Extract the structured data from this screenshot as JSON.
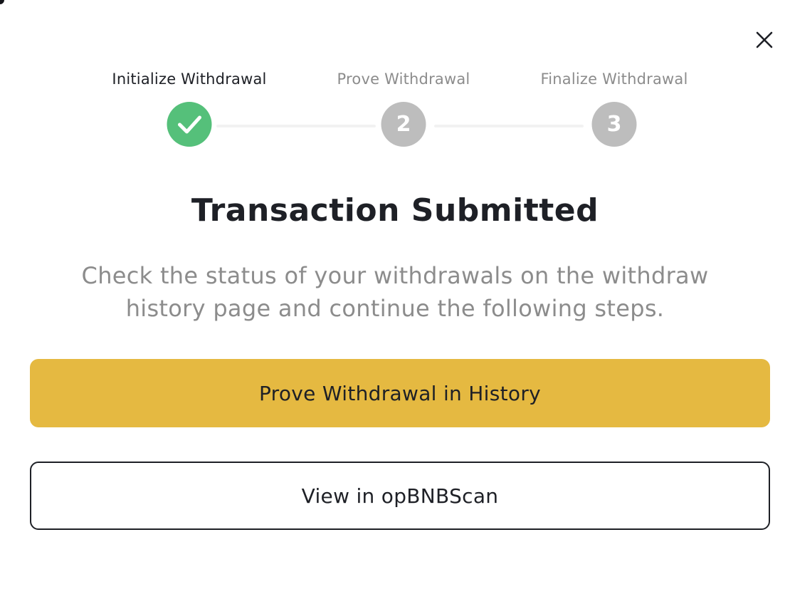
{
  "dialog": {
    "close_icon": "close-icon"
  },
  "steps": [
    {
      "label": "Initialize Withdrawal",
      "status": "complete",
      "icon": "check-icon"
    },
    {
      "label": "Prove Withdrawal",
      "status": "pending",
      "number": "2"
    },
    {
      "label": "Finalize Withdrawal",
      "status": "pending",
      "number": "3"
    }
  ],
  "content": {
    "title": "Transaction Submitted",
    "description": "Check the status of your withdrawals on the withdraw history page and continue the following steps."
  },
  "actions": {
    "primary_label": "Prove Withdrawal in History",
    "secondary_label": "View in opBNBScan"
  },
  "colors": {
    "complete": "#55c07a",
    "pending": "#bdbdbd",
    "primary_button": "#e5b941",
    "text": "#1e2026",
    "muted_text": "#8c8c8c"
  }
}
